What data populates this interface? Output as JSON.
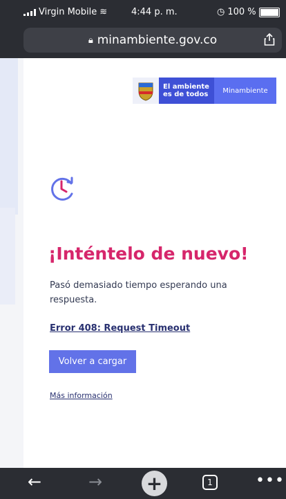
{
  "status_bar": {
    "carrier": "Virgin Mobile",
    "time": "4:44 p. m.",
    "battery": "100 %"
  },
  "browser": {
    "url": "minambiente.gov.co",
    "tab_count": "1"
  },
  "header": {
    "slogan_line1": "El ambiente",
    "slogan_line2": "es de todos",
    "ministry": "Minambiente"
  },
  "error_page": {
    "title": "¡Inténtelo de nuevo!",
    "description": "Pasó demasiado tiempo esperando una respuesta.",
    "error_link": "Error 408: Request Timeout",
    "reload_button": "Volver a cargar",
    "more_info_link": "Más información"
  },
  "colors": {
    "title": "#d6266b",
    "button": "#6272e8",
    "brand_dark": "#3e50d6",
    "brand_light": "#5a6ef0"
  },
  "icons": {
    "clock": "clock-refresh-icon",
    "lock": "lock-icon",
    "share": "share-icon"
  }
}
